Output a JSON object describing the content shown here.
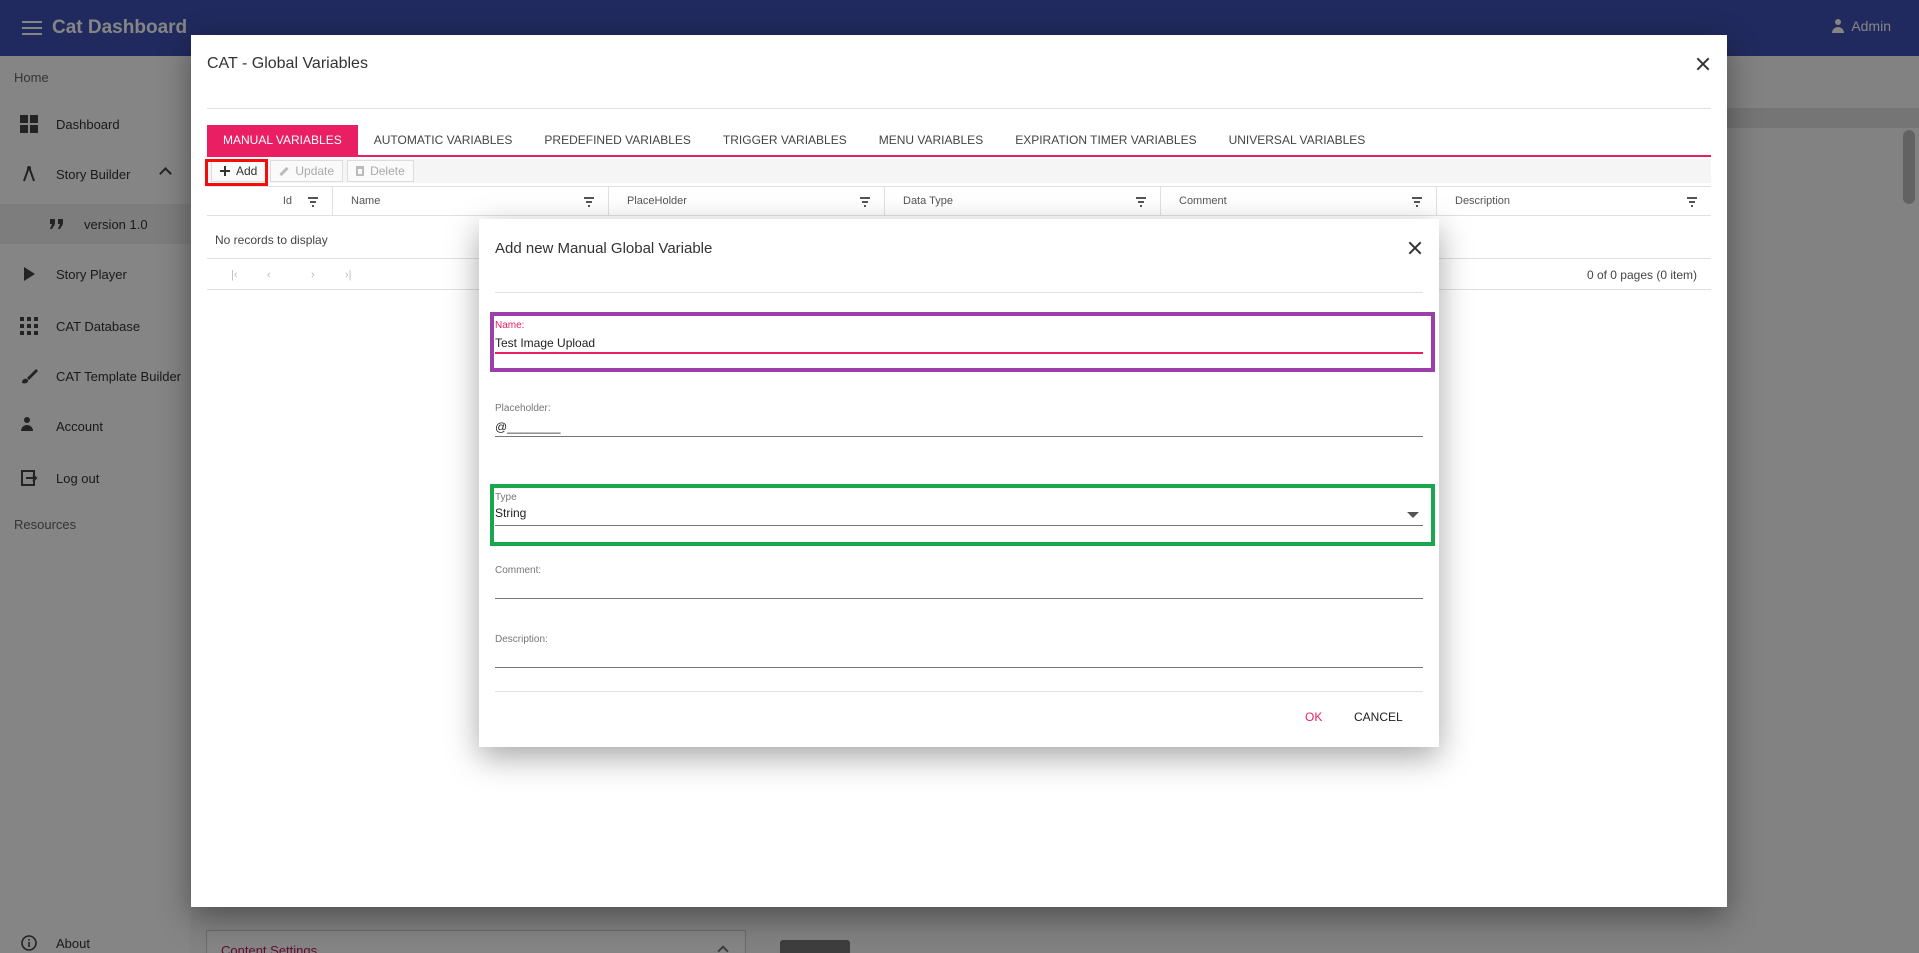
{
  "header": {
    "app_title": "Cat Dashboard",
    "user": "Admin"
  },
  "sidebar": {
    "home_heading": "Home",
    "items": [
      {
        "label": "Dashboard"
      },
      {
        "label": "Story Builder"
      },
      {
        "label": "version 1.0"
      },
      {
        "label": "Story Player"
      },
      {
        "label": "CAT Database"
      },
      {
        "label": "CAT Template Builder"
      },
      {
        "label": "Account"
      },
      {
        "label": "Log out"
      }
    ],
    "resources_heading": "Resources",
    "about": "About"
  },
  "background": {
    "content_settings": "Content Settings"
  },
  "gv_dialog": {
    "title": "CAT - Global Variables",
    "tabs": [
      {
        "label": "MANUAL VARIABLES"
      },
      {
        "label": "AUTOMATIC VARIABLES"
      },
      {
        "label": "PREDEFINED VARIABLES"
      },
      {
        "label": "TRIGGER VARIABLES"
      },
      {
        "label": "MENU VARIABLES"
      },
      {
        "label": "EXPIRATION TIMER VARIABLES"
      },
      {
        "label": "UNIVERSAL VARIABLES"
      }
    ],
    "toolbar": {
      "add": "Add",
      "update": "Update",
      "delete": "Delete"
    },
    "columns": [
      {
        "label": "Id"
      },
      {
        "label": "Name"
      },
      {
        "label": "PlaceHolder"
      },
      {
        "label": "Data Type"
      },
      {
        "label": "Comment"
      },
      {
        "label": "Description"
      }
    ],
    "empty_text": "No records to display",
    "pager_info": "0 of 0 pages (0 item)"
  },
  "add_dialog": {
    "title": "Add new Manual Global Variable",
    "name_label": "Name:",
    "name_value": "Test Image Upload",
    "placeholder_label": "Placeholder:",
    "placeholder_value": "@________",
    "type_label": "Type",
    "type_value": "String",
    "comment_label": "Comment:",
    "comment_value": "",
    "description_label": "Description:",
    "description_value": "",
    "ok": "OK",
    "cancel": "CANCEL"
  },
  "colors": {
    "header": "#3f51b5",
    "accent": "#e91e63",
    "highlight_red": "#f40d0d",
    "highlight_purple": "#9b40a8",
    "highlight_green": "#1aa64d"
  }
}
